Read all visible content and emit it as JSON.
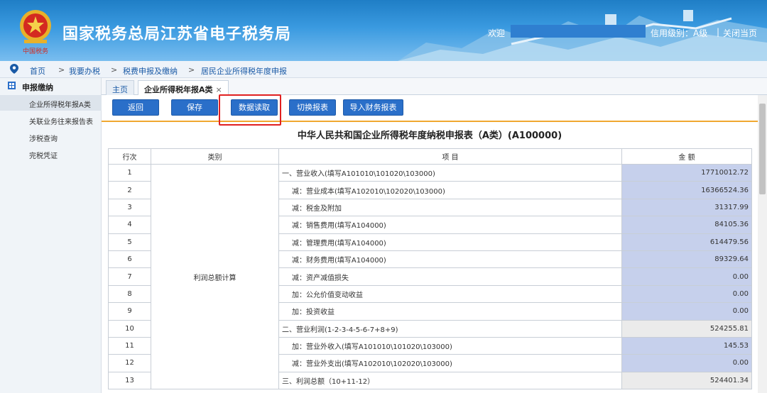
{
  "header": {
    "title": "国家税务总局江苏省电子税务局",
    "welcome": "欢迎",
    "credit_level": "信用级别：A级",
    "separator": "|",
    "close_page": "关闭当页",
    "emblem_text": "中国税务"
  },
  "breadcrumb": [
    "首页",
    "我要办税",
    "税费申报及缴纳",
    "居民企业所得税年度申报"
  ],
  "breadcrumb_separator": ">",
  "sidebar": {
    "heading": "申报缴纳",
    "items": [
      {
        "label": "企业所得税年报A类",
        "active": true
      },
      {
        "label": "关联业务往来报告表",
        "active": false
      },
      {
        "label": "涉税查询",
        "active": false
      },
      {
        "label": "完税凭证",
        "active": false
      }
    ]
  },
  "tabs": [
    {
      "label": "主页",
      "active": false
    },
    {
      "label": "企业所得税年报A类",
      "active": true,
      "close": "×"
    }
  ],
  "toolbar": {
    "back": "返回",
    "save": "保存",
    "data_read": "数据读取",
    "switch_report": "切换报表",
    "import_finance": "导入财务报表"
  },
  "form": {
    "title": "中华人民共和国企业所得税年度纳税申报表（A类）(A100000)",
    "headers": {
      "seq": "行次",
      "category": "类别",
      "item": "项  目",
      "amount": "金  额"
    },
    "category_profit": "利润总额计算",
    "rows": [
      {
        "seq": "1",
        "item": "一、营业收入(填写A101010\\101020\\103000)",
        "amount": "17710012.72",
        "kind": "input",
        "indent": false
      },
      {
        "seq": "2",
        "item": "减：营业成本(填写A102010\\102020\\103000)",
        "amount": "16366524.36",
        "kind": "input",
        "indent": true
      },
      {
        "seq": "3",
        "item": "减：税金及附加",
        "amount": "31317.99",
        "kind": "input",
        "indent": true
      },
      {
        "seq": "4",
        "item": "减：销售费用(填写A104000)",
        "amount": "84105.36",
        "kind": "input",
        "indent": true
      },
      {
        "seq": "5",
        "item": "减：管理费用(填写A104000)",
        "amount": "614479.56",
        "kind": "input",
        "indent": true
      },
      {
        "seq": "6",
        "item": "减：财务费用(填写A104000)",
        "amount": "89329.64",
        "kind": "input",
        "indent": true
      },
      {
        "seq": "7",
        "item": "减：资产减值损失",
        "amount": "0.00",
        "kind": "input",
        "indent": true
      },
      {
        "seq": "8",
        "item": "加：公允价值变动收益",
        "amount": "0.00",
        "kind": "input",
        "indent": true
      },
      {
        "seq": "9",
        "item": "加：投资收益",
        "amount": "0.00",
        "kind": "input",
        "indent": true
      },
      {
        "seq": "10",
        "item": "二、营业利润(1-2-3-4-5-6-7+8+9)",
        "amount": "524255.81",
        "kind": "calc",
        "indent": false
      },
      {
        "seq": "11",
        "item": "加：营业外收入(填写A101010\\101020\\103000)",
        "amount": "145.53",
        "kind": "input",
        "indent": true
      },
      {
        "seq": "12",
        "item": "减：营业外支出(填写A102010\\102020\\103000)",
        "amount": "0.00",
        "kind": "input",
        "indent": true
      },
      {
        "seq": "13",
        "item": "三、利润总额（10+11-12）",
        "amount": "524401.34",
        "kind": "calc",
        "indent": false
      }
    ]
  },
  "colors": {
    "header_top": "#1f7ec6",
    "button": "#2a6fc9",
    "input_cell": "#c6d0ec",
    "calc_cell": "#ebebeb",
    "highlight": "#e02020",
    "toolbar_underline": "#f0a830"
  }
}
